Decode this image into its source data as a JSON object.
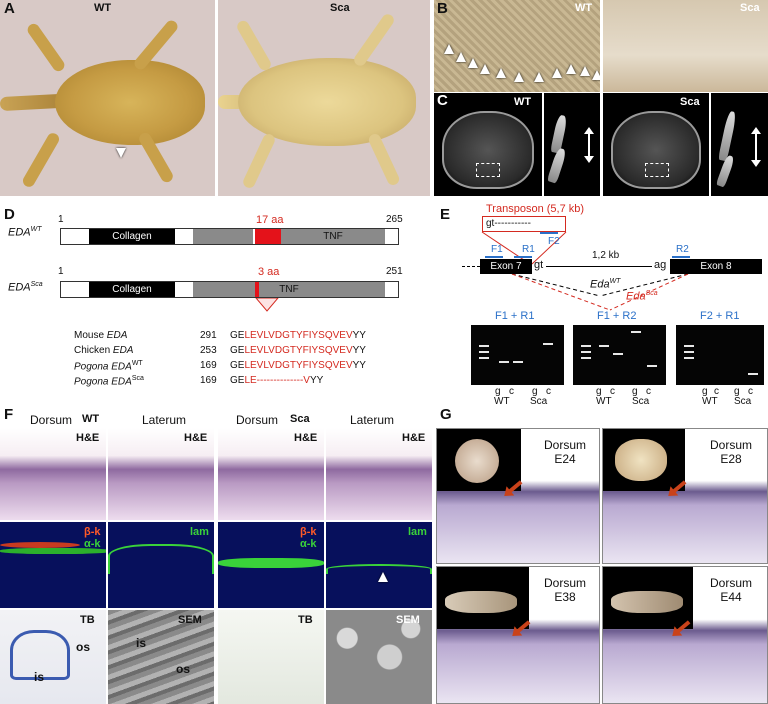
{
  "panels": {
    "A": {
      "letter": "A",
      "wt": "WT",
      "sca": "Sca"
    },
    "B": {
      "letter": "B",
      "wt": "WT",
      "sca": "Sca"
    },
    "C": {
      "letter": "C",
      "wt": "WT",
      "sca": "Sca"
    },
    "D": {
      "letter": "D",
      "wt_label": "EDA",
      "wt_sup": "WT",
      "sca_label": "EDA",
      "sca_sup": "Sca",
      "start_wt": "1",
      "end_wt": "265",
      "start_sca": "1",
      "end_sca": "251",
      "aa_wt": "17 aa",
      "aa_sca": "3 aa",
      "collagen": "Collagen",
      "tnf": "TNF",
      "alignment": [
        {
          "species": "Mouse ",
          "gene": "EDA",
          "sup": "",
          "pos": "291",
          "prefix": "GE",
          "red": "LEVLVDGTYFIYSQVEV",
          "suffix": "YY"
        },
        {
          "species": "Chicken ",
          "gene": "EDA",
          "sup": "",
          "pos": "253",
          "prefix": "GE",
          "red": "LEVLVDGTYFIYSQVEV",
          "suffix": "YY"
        },
        {
          "species": "Pogona ",
          "gene": "EDA",
          "sup": "WT",
          "pos": "169",
          "prefix": "GE",
          "red": "LEVLVDGTYFIYSQVEV",
          "suffix": "YY"
        },
        {
          "species": "Pogona ",
          "gene": "EDA",
          "sup": "Sca",
          "pos": "169",
          "prefix": "GE",
          "red": "LE--------------V",
          "suffix": "YY"
        }
      ]
    },
    "E": {
      "letter": "E",
      "transposon": "Transposon (5,7 kb)",
      "gt_box": "gt-----------",
      "f1": "F1",
      "r1": "R1",
      "f2": "F2",
      "r2": "R2",
      "exon7": "Exon 7",
      "exon8": "Exon 8",
      "gt": "gt",
      "ag": "ag",
      "kb": "1,2 kb",
      "eda_wt": "Eda",
      "eda_wt_sup": "WT",
      "eda_sca": "Eda",
      "eda_sca_sup": "Sca",
      "gels": [
        {
          "title": "F1 + R1"
        },
        {
          "title": "F1 + R2"
        },
        {
          "title": "F2 + R1"
        }
      ],
      "lanes": {
        "g": "g",
        "c": "c",
        "wt": "WT",
        "sca": "Sca"
      }
    },
    "F": {
      "letter": "F",
      "wt": "WT",
      "sca": "Sca",
      "dorsum": "Dorsum",
      "laterum": "Laterum",
      "he": "H&E",
      "bk": "β-k",
      "ak": "α-k",
      "lam": "lam",
      "tb": "TB",
      "sem": "SEM",
      "os": "os",
      "is": "is"
    },
    "G": {
      "letter": "G",
      "panels": [
        {
          "line1": "Dorsum",
          "line2": "E24"
        },
        {
          "line1": "Dorsum",
          "line2": "E28"
        },
        {
          "line1": "Dorsum",
          "line2": "E38"
        },
        {
          "line1": "Dorsum",
          "line2": "E44"
        }
      ]
    }
  }
}
